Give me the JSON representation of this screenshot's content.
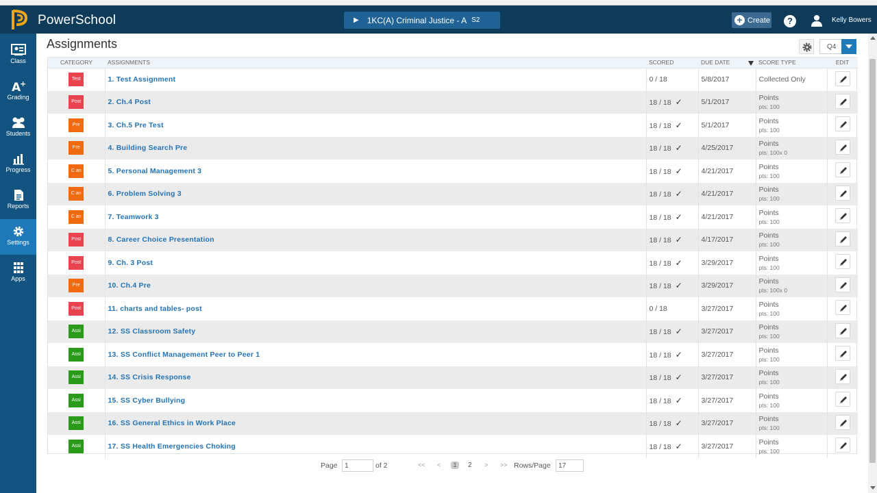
{
  "header": {
    "brand": "PowerSchool",
    "class_name": "1KC(A) Criminal Justice - A",
    "class_term": "S2",
    "create_label": "Create",
    "help_label": "?",
    "user_name": "Kelly Bowers"
  },
  "sidebar": {
    "items": [
      {
        "label": "Class",
        "icon": "class-icon"
      },
      {
        "label": "Grading",
        "icon": "grading-icon"
      },
      {
        "label": "Students",
        "icon": "students-icon"
      },
      {
        "label": "Progress",
        "icon": "progress-icon"
      },
      {
        "label": "Reports",
        "icon": "reports-icon"
      },
      {
        "label": "Settings",
        "icon": "settings-icon",
        "active": true
      },
      {
        "label": "Apps",
        "icon": "apps-icon"
      }
    ]
  },
  "page": {
    "title": "Assignments",
    "term_filter": "Q4"
  },
  "table": {
    "headers": {
      "category": "CATEGORY",
      "assignments": "ASSIGNMENTS",
      "scored": "SCORED",
      "due_date": "DUE DATE",
      "score_type": "SCORE TYPE",
      "edit": "EDIT"
    },
    "rows": [
      {
        "cat": "Test",
        "color": "#e8434f",
        "name": "1. Test Assignment",
        "scored": "0 / 18",
        "check": false,
        "due": "5/8/2017",
        "type": "Collected Only",
        "sub": ""
      },
      {
        "cat": "Post",
        "color": "#e8434f",
        "name": "2. Ch.4 Post",
        "scored": "18 / 18",
        "check": true,
        "due": "5/1/2017",
        "type": "Points",
        "sub": "pts: 100"
      },
      {
        "cat": "Pre",
        "color": "#f06a10",
        "name": "3. Ch.5 Pre Test",
        "scored": "18 / 18",
        "check": true,
        "due": "5/1/2017",
        "type": "Points",
        "sub": "pts: 100"
      },
      {
        "cat": "Pre",
        "color": "#f06a10",
        "name": "4. Building Search Pre",
        "scored": "18 / 18",
        "check": true,
        "due": "4/25/2017",
        "type": "Points",
        "sub": "pts: 100x 0"
      },
      {
        "cat": "C an",
        "color": "#f06a10",
        "name": "5. Personal Management 3",
        "scored": "18 / 18",
        "check": true,
        "due": "4/21/2017",
        "type": "Points",
        "sub": "pts: 100"
      },
      {
        "cat": "C an",
        "color": "#f06a10",
        "name": "6. Problem Solving 3",
        "scored": "18 / 18",
        "check": true,
        "due": "4/21/2017",
        "type": "Points",
        "sub": "pts: 100"
      },
      {
        "cat": "C an",
        "color": "#f06a10",
        "name": "7. Teamwork 3",
        "scored": "18 / 18",
        "check": true,
        "due": "4/21/2017",
        "type": "Points",
        "sub": "pts: 100"
      },
      {
        "cat": "Post",
        "color": "#e8434f",
        "name": "8. Career Choice Presentation",
        "scored": "18 / 18",
        "check": true,
        "due": "4/17/2017",
        "type": "Points",
        "sub": "pts: 100"
      },
      {
        "cat": "Post",
        "color": "#e8434f",
        "name": "9. Ch. 3 Post",
        "scored": "18 / 18",
        "check": true,
        "due": "3/29/2017",
        "type": "Points",
        "sub": "pts: 100"
      },
      {
        "cat": "Pre",
        "color": "#f06a10",
        "name": "10. Ch.4 Pre",
        "scored": "18 / 18",
        "check": true,
        "due": "3/29/2017",
        "type": "Points",
        "sub": "pts: 100x 0"
      },
      {
        "cat": "Post",
        "color": "#e8434f",
        "name": "11. charts and tables- post",
        "scored": "0 / 18",
        "check": false,
        "due": "3/27/2017",
        "type": "Points",
        "sub": "pts: 100"
      },
      {
        "cat": "Assi",
        "color": "#2a9a1a",
        "name": "12. SS Classroom Safety",
        "scored": "18 / 18",
        "check": true,
        "due": "3/27/2017",
        "type": "Points",
        "sub": "pts: 100"
      },
      {
        "cat": "Assi",
        "color": "#2a9a1a",
        "name": "13. SS Conflict Management Peer to Peer 1",
        "scored": "18 / 18",
        "check": true,
        "due": "3/27/2017",
        "type": "Points",
        "sub": "pts: 100"
      },
      {
        "cat": "Assi",
        "color": "#2a9a1a",
        "name": "14. SS Crisis Response",
        "scored": "18 / 18",
        "check": true,
        "due": "3/27/2017",
        "type": "Points",
        "sub": "pts: 100"
      },
      {
        "cat": "Assi",
        "color": "#2a9a1a",
        "name": "15. SS Cyber Bullying",
        "scored": "18 / 18",
        "check": true,
        "due": "3/27/2017",
        "type": "Points",
        "sub": "pts: 100"
      },
      {
        "cat": "Assi",
        "color": "#2a9a1a",
        "name": "16. SS General Ethics in Work Place",
        "scored": "18 / 18",
        "check": true,
        "due": "3/27/2017",
        "type": "Points",
        "sub": "pts: 100"
      },
      {
        "cat": "Assi",
        "color": "#2a9a1a",
        "name": "17. SS Health Emergencies Choking",
        "scored": "18 / 18",
        "check": true,
        "due": "3/27/2017",
        "type": "Points",
        "sub": "pts: 100"
      }
    ]
  },
  "pagination": {
    "page_label": "Page",
    "page_value": "1",
    "of_label": "of 2",
    "first": "<<",
    "prev": "<",
    "current": "1",
    "next_page": "2",
    "next": ">",
    "last": ">>",
    "rows_label": "Rows/Page",
    "rows_value": "17"
  },
  "colors": {
    "topbar": "#0f3b5a",
    "sidebar": "#12537f",
    "sidebar_active": "#1f78b8",
    "link": "#2473b5"
  }
}
